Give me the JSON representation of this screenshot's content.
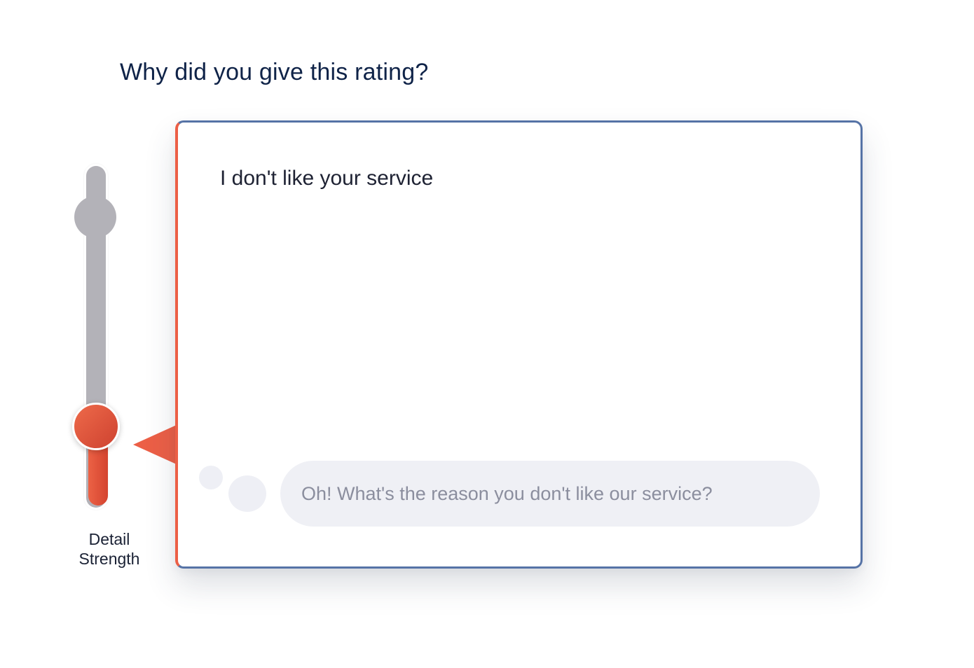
{
  "header": {
    "title": "Why did you give this rating?"
  },
  "slider": {
    "label_line1": "Detail",
    "label_line2": "Strength",
    "value_fraction": 0.2,
    "max_marker_fraction": 0.9,
    "colors": {
      "track": "#b3b2b8",
      "fill": "#e4553c",
      "thumb": "#e4553c"
    }
  },
  "card": {
    "response_text": "I don't like your service",
    "followup_question": "Oh! What's the reason you don't like our service?",
    "colors": {
      "border": "#5673a6",
      "accent": "#ec5f46",
      "bubble": "#eff0f5"
    }
  }
}
